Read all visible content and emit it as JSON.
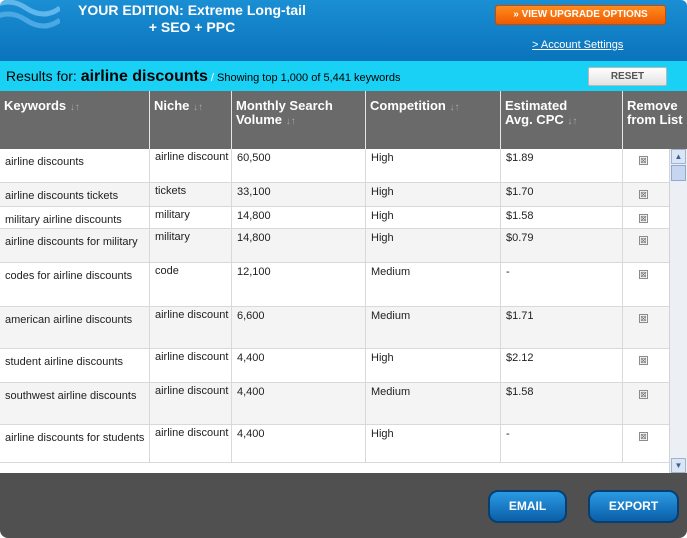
{
  "header": {
    "edition_line1": "YOUR EDITION: Extreme Long-tail",
    "edition_line2": "+ SEO + PPC",
    "upgrade_label": "» VIEW UPGRADE OPTIONS",
    "account_link": "> Account Settings"
  },
  "results": {
    "prefix": "Results for:",
    "keyword": "airline discounts",
    "showing_sep": " / ",
    "showing_text": "Showing top ",
    "shown_count": "1,000",
    "of_text": " of ",
    "total_count": "5,441",
    "suffix": " keywords",
    "reset_label": "RESET"
  },
  "columns": {
    "keywords": "Keywords",
    "niche": "Niche",
    "volume": "Monthly Search Volume",
    "competition": "Competition",
    "cpc": "Estimated Avg. CPC",
    "remove": "Remove from List",
    "sort_glyph": "↓↑"
  },
  "rows": [
    {
      "keyword": "airline discounts",
      "niche": "airline discount",
      "volume": "60,500",
      "competition": "High",
      "cpc": "$1.89"
    },
    {
      "keyword": "airline discounts tickets",
      "niche": "tickets",
      "volume": "33,100",
      "competition": "High",
      "cpc": "$1.70"
    },
    {
      "keyword": "military airline discounts",
      "niche": "military",
      "volume": "14,800",
      "competition": "High",
      "cpc": "$1.58"
    },
    {
      "keyword": "airline discounts for military",
      "niche": "military",
      "volume": "14,800",
      "competition": "High",
      "cpc": "$0.79"
    },
    {
      "keyword": "codes for airline discounts",
      "niche": "code",
      "volume": "12,100",
      "competition": "Medium",
      "cpc": "-"
    },
    {
      "keyword": "american airline discounts",
      "niche": "airline discount",
      "volume": "6,600",
      "competition": "Medium",
      "cpc": "$1.71"
    },
    {
      "keyword": "student airline discounts",
      "niche": "airline discount",
      "volume": "4,400",
      "competition": "High",
      "cpc": "$2.12"
    },
    {
      "keyword": "southwest airline discounts",
      "niche": "airline discount",
      "volume": "4,400",
      "competition": "Medium",
      "cpc": "$1.58"
    },
    {
      "keyword": "airline discounts for students",
      "niche": "airline discount",
      "volume": "4,400",
      "competition": "High",
      "cpc": "-"
    }
  ],
  "icons": {
    "remove": "⊠",
    "scroll_up": "▲",
    "scroll_down": "▼"
  },
  "footer": {
    "email_label": "EMAIL",
    "export_label": "EXPORT"
  },
  "colors": {
    "header_blue": "#0a73bb",
    "results_cyan": "#18d1f5",
    "upgrade_orange": "#f05a00",
    "table_header": "#6a6a6a",
    "footer": "#505050"
  }
}
